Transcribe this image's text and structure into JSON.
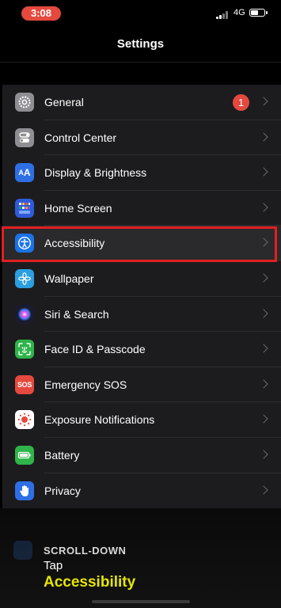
{
  "status_bar": {
    "time": "3:08",
    "network": "4G"
  },
  "nav": {
    "title": "Settings"
  },
  "settings_rows": [
    {
      "label": "General",
      "icon": "gear-icon",
      "color": "#8e8e93",
      "badge": "1"
    },
    {
      "label": "Control Center",
      "icon": "toggles-icon",
      "color": "#8e8e93"
    },
    {
      "label": "Display & Brightness",
      "icon": "text-size-icon",
      "color": "#2f6fe6"
    },
    {
      "label": "Home Screen",
      "icon": "app-grid-icon",
      "color": "#2f5bd8"
    },
    {
      "label": "Accessibility",
      "icon": "accessibility-icon",
      "color": "#1a73e8"
    },
    {
      "label": "Wallpaper",
      "icon": "flower-icon",
      "color": "#2b9fe0"
    },
    {
      "label": "Siri & Search",
      "icon": "siri-icon",
      "color": "#1b1b2e"
    },
    {
      "label": "Face ID & Passcode",
      "icon": "face-id-icon",
      "color": "#2fb34a"
    },
    {
      "label": "Emergency SOS",
      "icon": "sos-icon",
      "color": "#e5493e"
    },
    {
      "label": "Exposure Notifications",
      "icon": "exposure-icon",
      "color": "#ffffff"
    },
    {
      "label": "Battery",
      "icon": "battery-icon",
      "color": "#2fb34a"
    },
    {
      "label": "Privacy",
      "icon": "hand-icon",
      "color": "#2f6fe6"
    }
  ],
  "instruction": {
    "line1": "SCROLL-DOWN",
    "line2": "Tap",
    "line3": "Accessibility"
  },
  "colors": {
    "accent": "#e6e600",
    "highlight": "#e12020",
    "badge": "#e5493e"
  }
}
